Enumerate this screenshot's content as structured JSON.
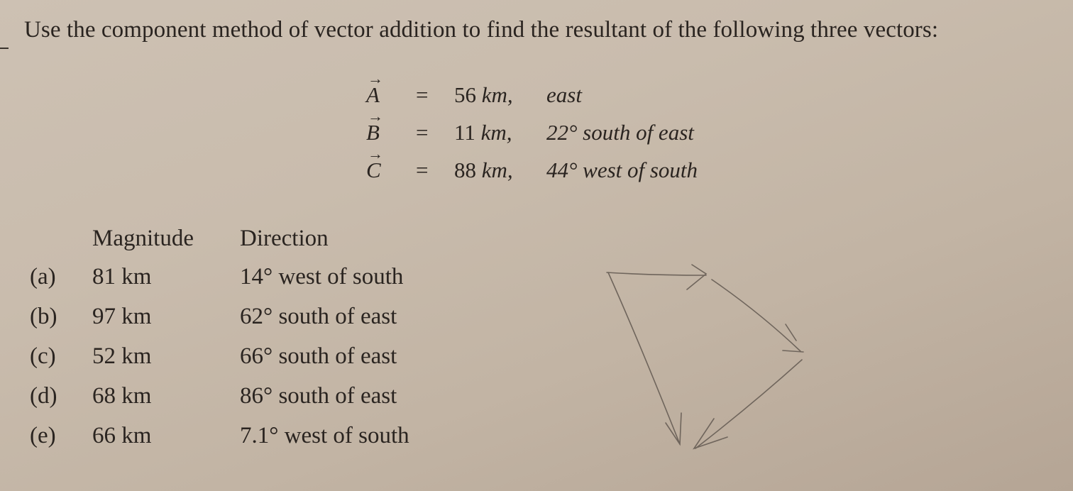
{
  "question": "Use the component method of vector addition to find the resultant of the following three vectors:",
  "vectors": [
    {
      "name": "A",
      "eq": "=",
      "magnitude": "56",
      "unit": "km,",
      "direction": "east"
    },
    {
      "name": "B",
      "eq": "=",
      "magnitude": "11",
      "unit": "km,",
      "direction": "22° south of east"
    },
    {
      "name": "C",
      "eq": "=",
      "magnitude": "88",
      "unit": "km,",
      "direction": "44° west of south"
    }
  ],
  "table": {
    "headers": {
      "magnitude": "Magnitude",
      "direction": "Direction"
    },
    "options": [
      {
        "label": "(a)",
        "magnitude": "81 km",
        "direction": "14° west of south"
      },
      {
        "label": "(b)",
        "magnitude": "97 km",
        "direction": "62° south of east"
      },
      {
        "label": "(c)",
        "magnitude": "52 km",
        "direction": "66° south of east"
      },
      {
        "label": "(d)",
        "magnitude": "68 km",
        "direction": "86° south of east"
      },
      {
        "label": "(e)",
        "magnitude": "66 km",
        "direction": "7.1° west of south"
      }
    ]
  },
  "sketch": {
    "description": "hand-drawn vector addition diagram: A east, B southeast, C southwest, resultant from start"
  }
}
